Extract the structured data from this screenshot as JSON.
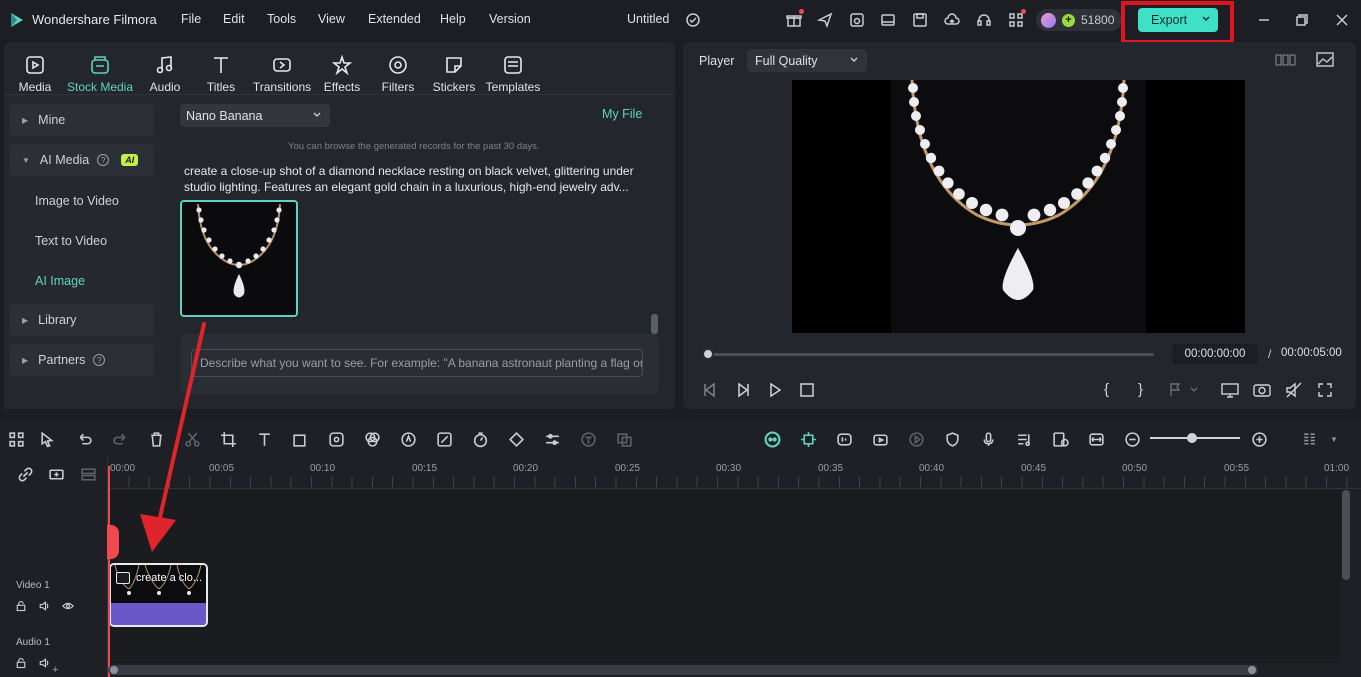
{
  "app": {
    "name": "Wondershare Filmora",
    "project_title": "Untitled",
    "credits": "51800",
    "export_label": "Export"
  },
  "menu": [
    "File",
    "Edit",
    "Tools",
    "View",
    "Extended",
    "Help",
    "Version"
  ],
  "tabs": [
    {
      "label": "Media",
      "icon": "media-icon"
    },
    {
      "label": "Stock Media",
      "icon": "stock-media-icon"
    },
    {
      "label": "Audio",
      "icon": "audio-icon"
    },
    {
      "label": "Titles",
      "icon": "titles-icon"
    },
    {
      "label": "Transitions",
      "icon": "transitions-icon"
    },
    {
      "label": "Effects",
      "icon": "effects-icon"
    },
    {
      "label": "Filters",
      "icon": "filters-icon"
    },
    {
      "label": "Stickers",
      "icon": "stickers-icon"
    },
    {
      "label": "Templates",
      "icon": "templates-icon"
    }
  ],
  "sidebar": {
    "mine": "Mine",
    "ai_media": "AI Media",
    "ai_badge": "AI",
    "image_to_video": "Image to Video",
    "text_to_video": "Text to Video",
    "ai_image": "AI Image",
    "library": "Library",
    "partners": "Partners"
  },
  "content": {
    "model_select": "Nano Banana",
    "my_file": "My File",
    "history_note": "You can browse the generated records for the past 30 days.",
    "prompt_text": "create a close-up shot of a diamond necklace resting on black velvet, glittering under studio lighting. Features an elegant gold chain in a luxurious, high-end jewelry adv...",
    "prompt_placeholder": "Describe what you want to see. For example: \"A banana astronaut planting a flag on the moon\""
  },
  "player": {
    "label": "Player",
    "quality": "Full Quality",
    "current_time": "00:00:00:00",
    "separator": "/",
    "total_time": "00:00:05:00"
  },
  "timeline": {
    "ruler": [
      "00:00",
      "00:05",
      "00:10",
      "00:15",
      "00:20",
      "00:25",
      "00:30",
      "00:35",
      "00:40",
      "00:45",
      "00:50",
      "00:55",
      "01:00"
    ],
    "video_track": "Video 1",
    "audio_track": "Audio 1",
    "clip_label": "create a clo..."
  },
  "colors": {
    "accent": "#5fd3bf",
    "export_bg": "#3fe0c5",
    "highlight_box": "#e0141e",
    "arrow": "#e0242c",
    "clip_bar": "#6b58c8",
    "playhead": "#f0484f"
  }
}
